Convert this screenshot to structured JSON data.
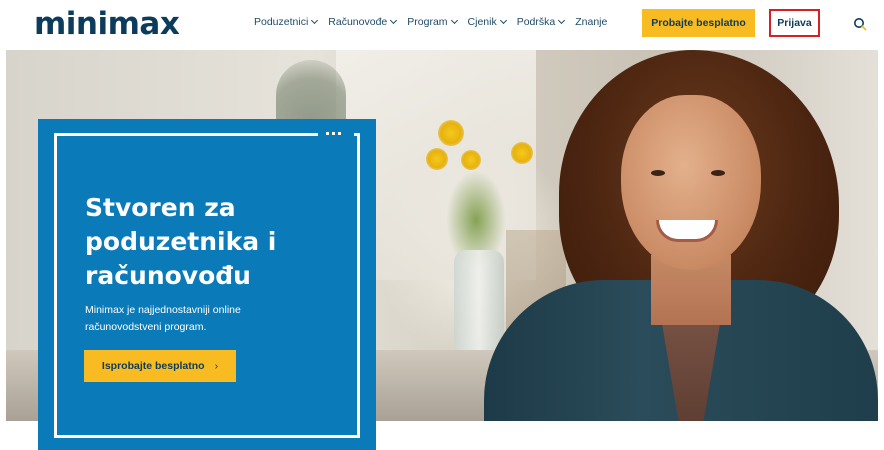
{
  "header": {
    "logo": "minimax",
    "nav": [
      {
        "label": "Poduzetnici",
        "has_dropdown": true
      },
      {
        "label": "Računovođe",
        "has_dropdown": true
      },
      {
        "label": "Program",
        "has_dropdown": true
      },
      {
        "label": "Cjenik",
        "has_dropdown": true
      },
      {
        "label": "Podrška",
        "has_dropdown": true
      },
      {
        "label": "Znanje",
        "has_dropdown": false
      }
    ],
    "try_button": "Probajte besplatno",
    "login_button": "Prijava",
    "search_icon": "search-icon"
  },
  "hero": {
    "title": "Stvoren za poduzetnika i računovođu",
    "subtitle": "Minimax je najjednostavniji online računovodstveni program.",
    "cta": "Isprobajte besplatno",
    "cta_arrow": "›"
  },
  "colors": {
    "brand_dark": "#0d3b5c",
    "card_blue": "#0a7ab8",
    "accent_yellow": "#f8bb22",
    "login_border": "#d61f26"
  }
}
